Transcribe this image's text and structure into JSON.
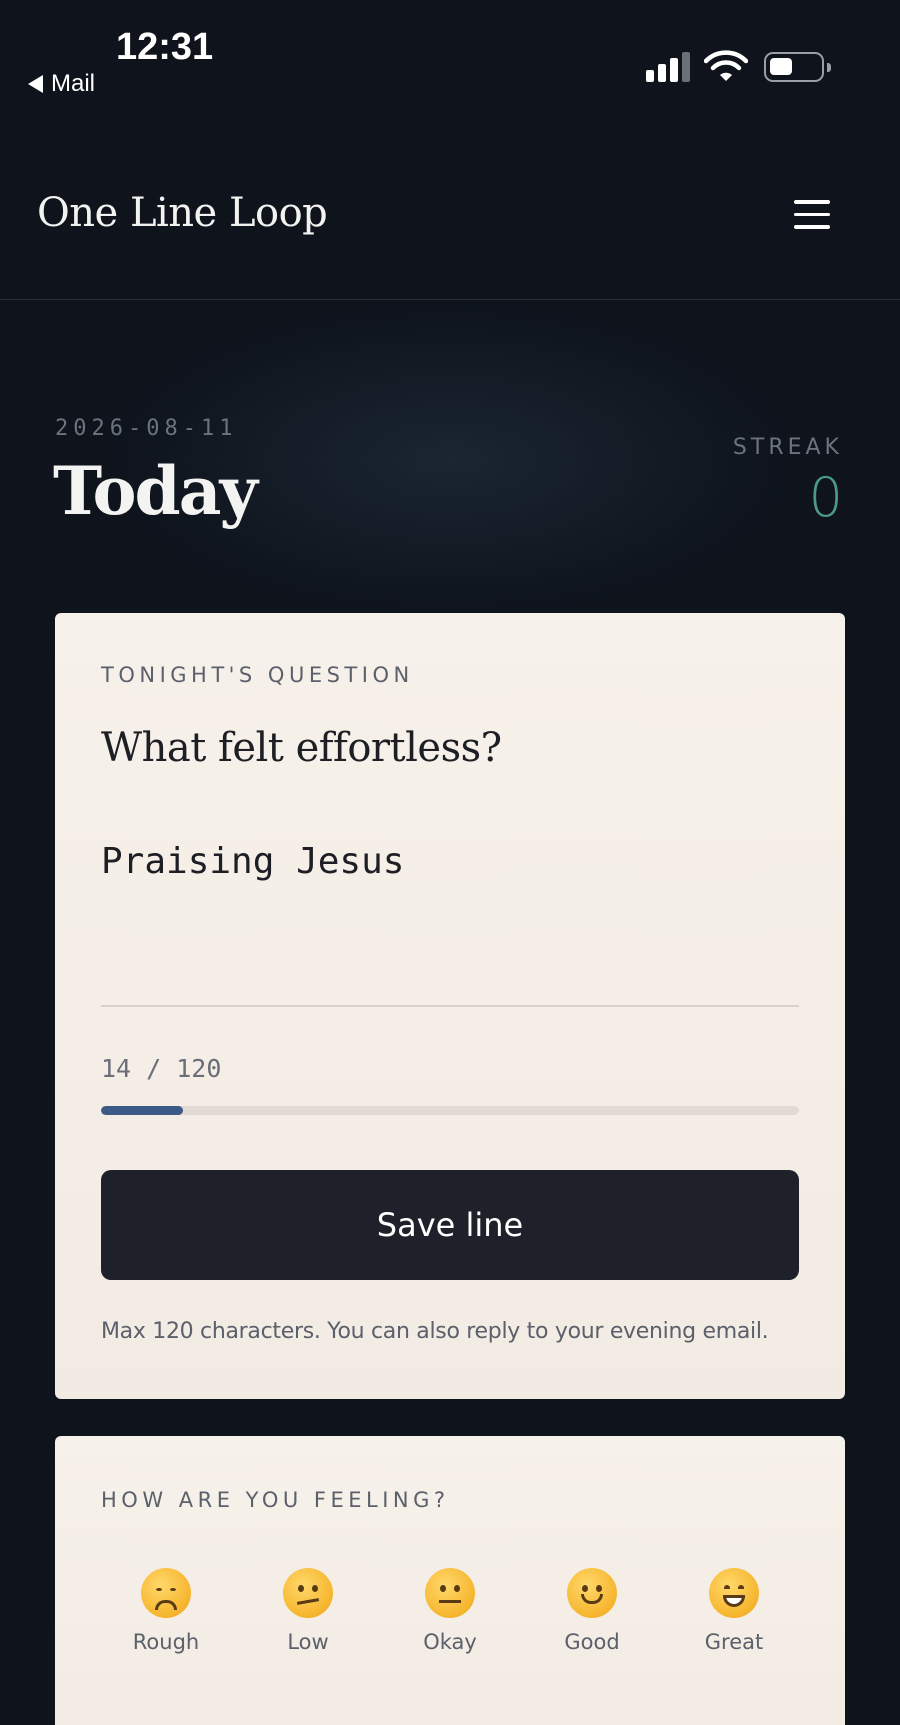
{
  "status_bar": {
    "time": "12:31",
    "back_label": "Mail"
  },
  "header": {
    "app_title": "One Line Loop"
  },
  "today": {
    "date": "2026-08-11",
    "title": "Today",
    "streak_label": "STREAK",
    "streak_value": "0"
  },
  "question_card": {
    "overline": "TONIGHT'S QUESTION",
    "question": "What felt effortless?",
    "answer_value": "Praising Jesus",
    "counter": "14 / 120",
    "progress_fraction": 0.117,
    "save_label": "Save line",
    "help_text": "Max 120 characters. You can also reply to your evening email."
  },
  "feeling_card": {
    "overline": "HOW ARE YOU FEELING?",
    "moods": [
      {
        "label": "Rough",
        "icon": "disappointed-face-icon"
      },
      {
        "label": "Low",
        "icon": "confused-face-icon"
      },
      {
        "label": "Okay",
        "icon": "neutral-face-icon"
      },
      {
        "label": "Good",
        "icon": "slightly-smiling-face-icon"
      },
      {
        "label": "Great",
        "icon": "grinning-face-icon"
      }
    ]
  },
  "colors": {
    "background": "#0e131c",
    "card": "#f6f1ea",
    "accent_streak": "#4d9987",
    "progress": "#3b5a86",
    "button": "#1e2129"
  }
}
